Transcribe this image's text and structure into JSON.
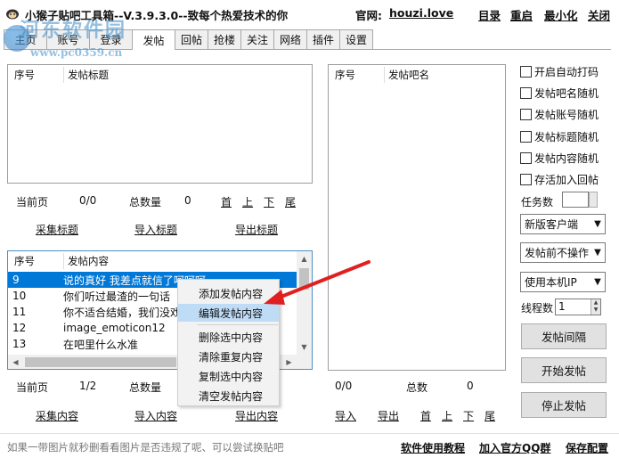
{
  "window": {
    "title": "小猴子贴吧工具箱--V.3.9.3.0--致每个热爱技术的你",
    "site_label": "官网:",
    "site_url": "houzi.love",
    "links": [
      "目录",
      "重启",
      "最小化",
      "关闭"
    ]
  },
  "watermark": {
    "name": "河东软件园",
    "url": "www.pc0359.cn"
  },
  "tabs": [
    "主页",
    "账号",
    "登录",
    "发帖",
    "回帖",
    "抢楼",
    "关注",
    "网络",
    "插件",
    "设置"
  ],
  "active_tab": "发帖",
  "titles_panel": {
    "col_num": "序号",
    "col_title": "发帖标题",
    "current_page_label": "当前页",
    "current_page": "0/0",
    "total_label": "总数量",
    "total": "0",
    "nav": [
      "首",
      "上",
      "下",
      "尾"
    ],
    "actions": [
      "采集标题",
      "导入标题",
      "导出标题"
    ]
  },
  "content_panel": {
    "col_num": "序号",
    "col_content": "发帖内容",
    "rows": [
      {
        "num": "9",
        "text": "说的真好 我差点就信了呵呵呵",
        "selected": true
      },
      {
        "num": "10",
        "text": "你们听过最渣的一句话"
      },
      {
        "num": "11",
        "text": "你不适合结婚，我们没戏"
      },
      {
        "num": "12",
        "text": "image_emoticon12"
      },
      {
        "num": "13",
        "text": "在吧里什么水准"
      }
    ],
    "current_page_label": "当前页",
    "current_page": "1/2",
    "total_label": "总数量",
    "actions": [
      "采集内容",
      "导入内容",
      "导出内容"
    ]
  },
  "bars_panel": {
    "col_num": "序号",
    "col_name": "发帖吧名",
    "current_page": "0/0",
    "total_label": "总数",
    "total": "0",
    "actions": [
      "导入",
      "导出"
    ],
    "nav": [
      "首",
      "上",
      "下",
      "尾"
    ]
  },
  "options": {
    "checkboxes": [
      "开启自动打码",
      "发帖吧名随机",
      "发帖账号随机",
      "发帖标题随机",
      "发帖内容随机",
      "存活加入回帖"
    ],
    "task_count_label": "任务数",
    "client_select": "新版客户端",
    "pre_post_select": "发帖前不操作",
    "ip_select": "使用本机IP",
    "thread_label": "线程数",
    "thread_value": "1",
    "buttons": [
      "发帖间隔",
      "开始发帖",
      "停止发帖"
    ]
  },
  "context_menu": {
    "items": [
      "添加发帖内容",
      "编辑发帖内容",
      "删除选中内容",
      "清除重复内容",
      "复制选中内容",
      "清空发帖内容"
    ],
    "highlighted": "编辑发帖内容"
  },
  "status": {
    "tip": "如果一带图片就秒删看看图片是否违规了呢、可以尝试换贴吧",
    "links": [
      "软件使用教程",
      "加入官方QQ群",
      "保存配置"
    ]
  },
  "colors": {
    "selection": "#0078d7",
    "arrow": "#e02020",
    "watermark": "#3c8cc8"
  }
}
